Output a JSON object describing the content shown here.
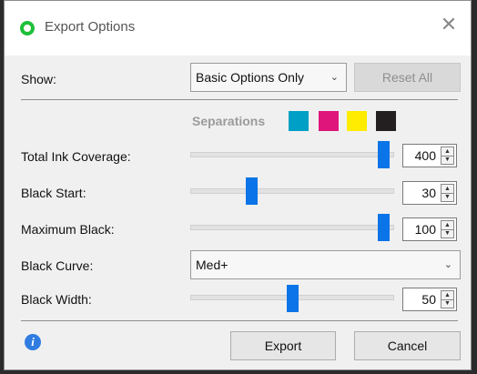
{
  "window": {
    "title": "Export Options"
  },
  "show": {
    "label": "Show:",
    "selected": "Basic Options Only"
  },
  "reset_label": "Reset All",
  "separations": {
    "label": "Separations",
    "swatches": [
      "#00a0c6",
      "#e0157c",
      "#ffec00",
      "#231f20"
    ]
  },
  "rows": [
    {
      "label": "Total Ink Coverage:",
      "value": "400",
      "slider_fraction": 0.95
    },
    {
      "label": "Black Start:",
      "value": "30",
      "slider_fraction": 0.3
    },
    {
      "label": "Maximum Black:",
      "value": "100",
      "slider_fraction": 0.95
    }
  ],
  "black_curve": {
    "label": "Black Curve:",
    "selected": "Med+"
  },
  "black_width": {
    "label": "Black Width:",
    "value": "50",
    "slider_fraction": 0.5
  },
  "buttons": {
    "export": "Export",
    "cancel": "Cancel"
  },
  "accent_color": "#0a74e8"
}
